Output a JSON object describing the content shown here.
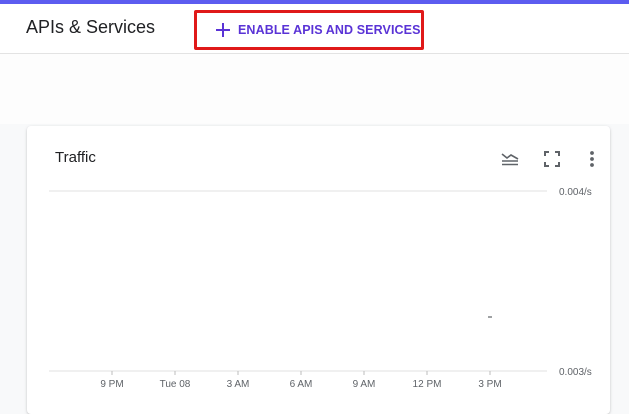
{
  "header": {
    "title": "APIs & Services",
    "enable_button_label": "ENABLE APIS AND SERVICES"
  },
  "colors": {
    "accent_bar": "#5c5cf0",
    "highlight_box": "#e01919",
    "button_text": "#5a33d6",
    "gridline": "#e0e0e0"
  },
  "card": {
    "title": "Traffic",
    "icons": [
      "legend-toggle-icon",
      "fullscreen-icon",
      "more-vert-icon"
    ]
  },
  "chart_data": {
    "type": "line",
    "title": "Traffic",
    "x": [
      "9 PM",
      "Tue 08",
      "3 AM",
      "6 AM",
      "9 AM",
      "12 PM",
      "3 PM"
    ],
    "y_ticks": [
      "0.004/s",
      "0.003/s"
    ],
    "ylim": [
      0.003,
      0.004
    ],
    "grid": true,
    "series": [
      {
        "points": [
          {
            "x": "3 PM",
            "y": 0.0033
          }
        ]
      }
    ]
  }
}
